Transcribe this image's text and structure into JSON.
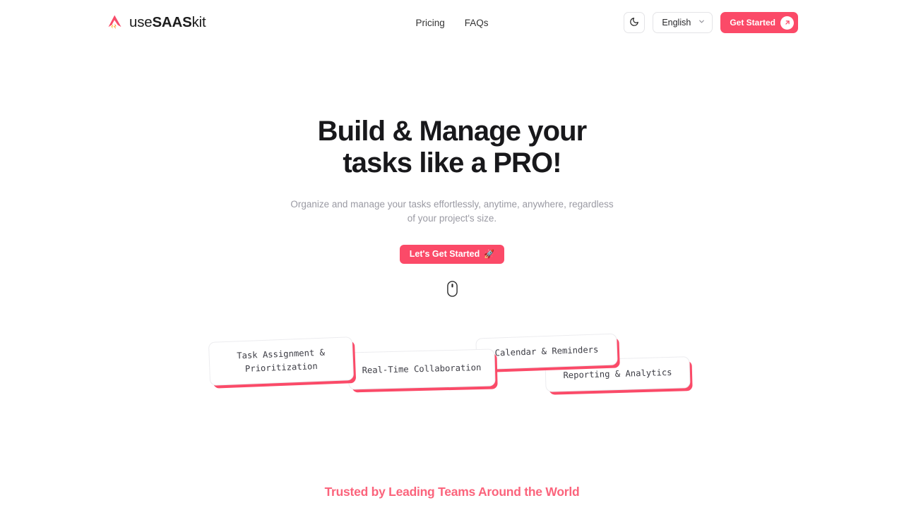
{
  "theme": {
    "accent": "#fb4a68",
    "accent_soft": "#fb647c",
    "heading": "#18181b",
    "muted": "#9a9aa3",
    "page_bg": "#ffffff"
  },
  "header": {
    "brand": {
      "icon": "usesaaskit-logo-icon",
      "prefix": "use",
      "emphasis": "SAAS",
      "suffix": "kit"
    },
    "nav": [
      {
        "label": "Pricing",
        "name": "nav-link-pricing"
      },
      {
        "label": "FAQs",
        "name": "nav-link-faqs"
      }
    ],
    "theme_toggle": {
      "icon": "moon-icon",
      "title": "Toggle dark mode"
    },
    "language": {
      "icon": "chevron-down-icon",
      "selected": "English",
      "options": [
        "English"
      ]
    },
    "cta": {
      "label": "Get Started",
      "icon": "arrow-up-right-icon"
    }
  },
  "hero": {
    "title_line1": "Build & Manage your",
    "title_line2": "tasks like a PRO!",
    "subtitle": "Organize and manage your tasks effortlessly, anytime, anywhere, regardless of your project's size.",
    "cta": {
      "label": "Let's Get Started",
      "emoji": "🚀"
    },
    "scroll_hint_icon": "mouse-scroll-icon"
  },
  "features": {
    "cards": [
      {
        "label": "Task Assignment &\nPrioritization",
        "name": "feature-card-task-assignment"
      },
      {
        "label": "Real-Time Collaboration",
        "name": "feature-card-real-time-collaboration"
      },
      {
        "label": "Calendar & Reminders",
        "name": "feature-card-calendar-reminders"
      },
      {
        "label": "Reporting & Analytics",
        "name": "feature-card-reporting-analytics"
      }
    ]
  },
  "trusted": {
    "title": "Trusted by Leading Teams Around the World"
  }
}
